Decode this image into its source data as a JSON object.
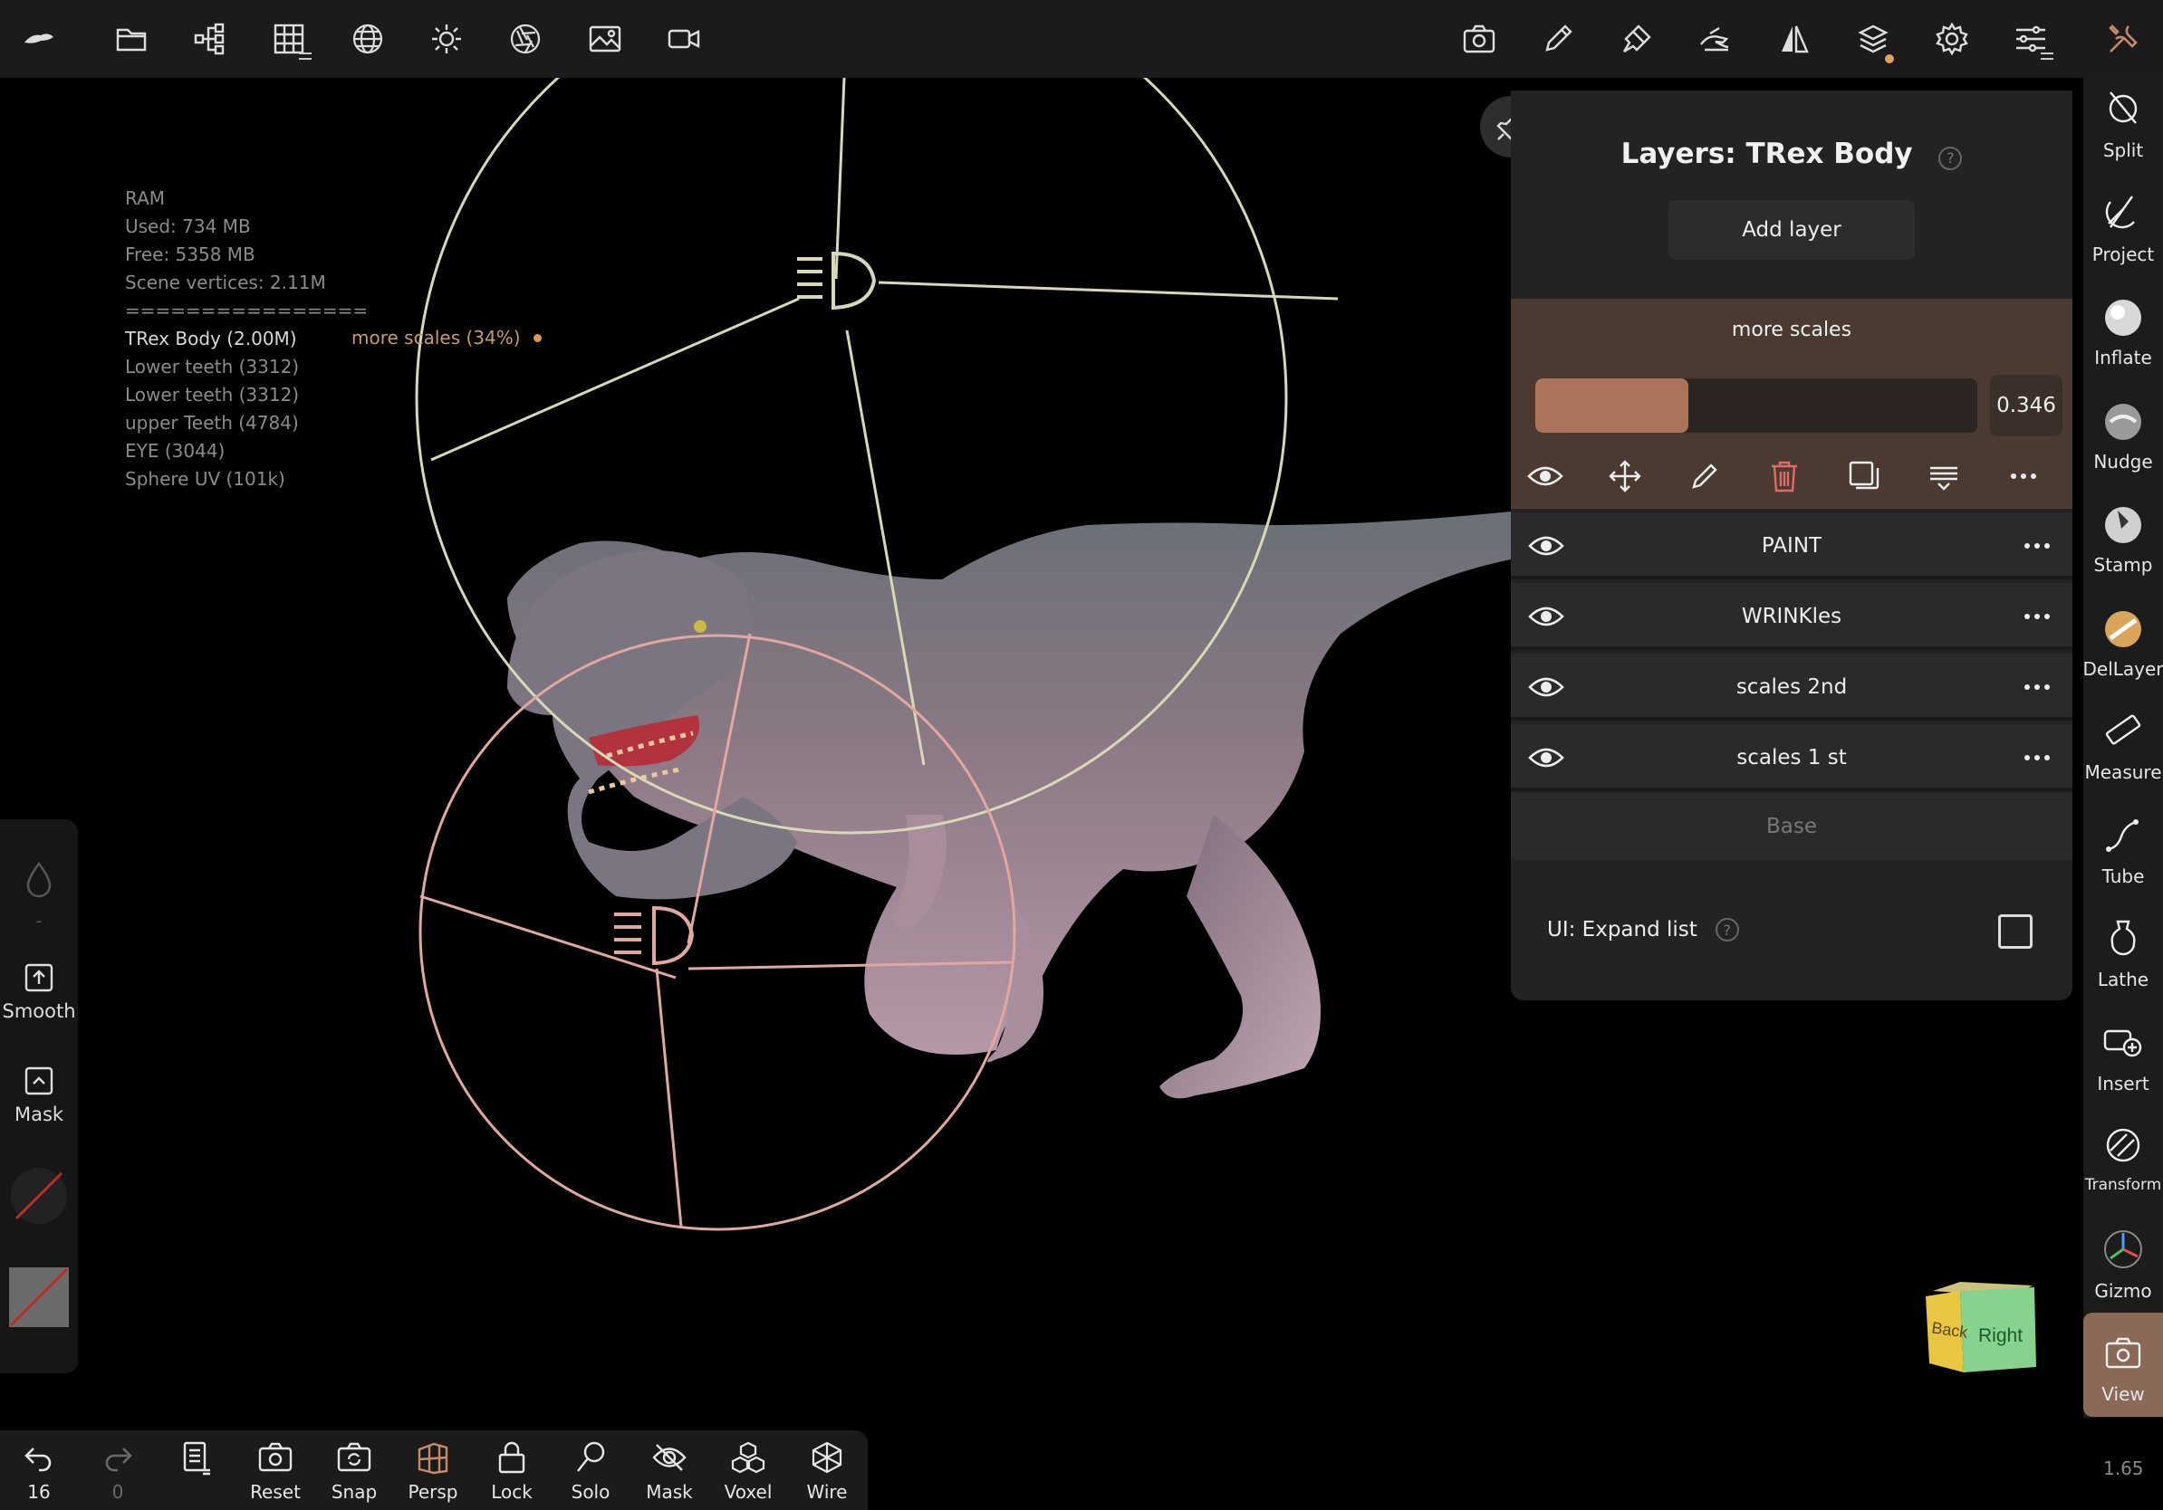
{
  "topbar": {
    "left_icons": [
      "app-logo-icon",
      "folder-icon",
      "scene-tree-icon",
      "topology-grid-icon",
      "material-sphere-icon",
      "light-sun-icon",
      "camera-aperture-icon",
      "background-image-icon",
      "video-icon"
    ],
    "right_icons": [
      "screenshot-camera-icon",
      "pencil-icon",
      "stroke-brush-icon",
      "painting-hand-icon",
      "symmetry-icon",
      "layers-icon",
      "settings-gear-icon",
      "sliders-icon",
      "tools-icon"
    ]
  },
  "stats": {
    "ram_label": "RAM",
    "used": "Used: 734 MB",
    "free": "Free: 5358 MB",
    "vertices": "Scene vertices: 2.11M",
    "separator": "================",
    "meshes": [
      "TRex Body (2.00M)",
      "Lower teeth (3312)",
      "Lower teeth (3312)",
      "upper Teeth  (4784)",
      "EYE (3044)",
      "Sphere UV (101k)"
    ],
    "active_layer_note": "more scales (34%)"
  },
  "left_panel": {
    "dash": "-",
    "smooth_label": "Smooth",
    "mask_label": "Mask"
  },
  "layers_panel": {
    "title": "Layers: TRex Body",
    "add_layer": "Add layer",
    "active": {
      "name": "more scales",
      "value": "0.346",
      "fraction": 0.346
    },
    "layers": [
      {
        "name": "PAINT"
      },
      {
        "name": "WRINKles"
      },
      {
        "name": "scales 2nd"
      },
      {
        "name": "scales 1 st"
      }
    ],
    "base": "Base",
    "expand_list_label": "UI: Expand list"
  },
  "right_tools": [
    {
      "label": "Split",
      "icon": "split-icon"
    },
    {
      "label": "Project",
      "icon": "project-icon"
    },
    {
      "label": "Inflate",
      "icon": "inflate-icon"
    },
    {
      "label": "Nudge",
      "icon": "nudge-icon"
    },
    {
      "label": "Stamp",
      "icon": "stamp-icon"
    },
    {
      "label": "DelLayer",
      "icon": "dellayer-icon"
    },
    {
      "label": "Measure",
      "icon": "ruler-icon"
    },
    {
      "label": "Tube",
      "icon": "tube-icon"
    },
    {
      "label": "Lathe",
      "icon": "lathe-icon"
    },
    {
      "label": "Insert",
      "icon": "insert-icon"
    },
    {
      "label": "Transform",
      "icon": "transform-icon"
    },
    {
      "label": "Gizmo",
      "icon": "gizmo-icon"
    },
    {
      "label": "View",
      "icon": "view-camera-icon"
    }
  ],
  "bottombar": {
    "undo_count": "16",
    "redo_count": "0",
    "reset": "Reset",
    "snap": "Snap",
    "persp": "Persp",
    "lock": "Lock",
    "solo": "Solo",
    "mask": "Mask",
    "voxel": "Voxel",
    "wire": "Wire"
  },
  "viewcube": {
    "back": "Back",
    "right": "Right"
  },
  "version": "1.65",
  "colors": {
    "accent": "#ab7359",
    "active_layer_bg": "#4a3a31",
    "light_ring_1": "#d8d8b8",
    "light_ring_2": "#e0a8a0"
  }
}
